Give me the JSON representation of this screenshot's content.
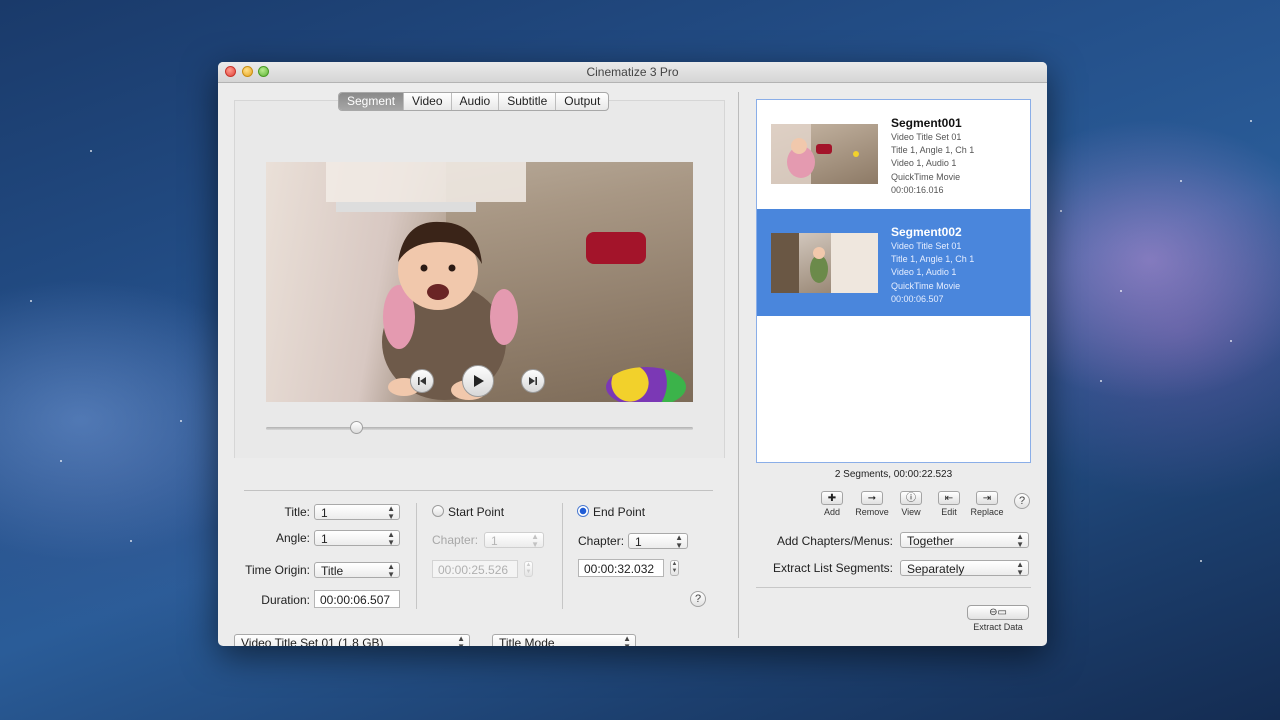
{
  "window": {
    "title": "Cinematize 3 Pro"
  },
  "tabs": [
    {
      "label": "Segment",
      "active": true
    },
    {
      "label": "Video",
      "active": false
    },
    {
      "label": "Audio",
      "active": false
    },
    {
      "label": "Subtitle",
      "active": false
    },
    {
      "label": "Output",
      "active": false
    }
  ],
  "player": {
    "position_fraction": 0.21
  },
  "props": {
    "title_label": "Title:",
    "title_value": "1",
    "angle_label": "Angle:",
    "angle_value": "1",
    "time_origin_label": "Time Origin:",
    "time_origin_value": "Title",
    "duration_label": "Duration:",
    "duration_value": "00:00:06.507",
    "start_point_label": "Start Point",
    "start_chapter_label": "Chapter:",
    "start_chapter_value": "1",
    "start_time": "00:00:25.526",
    "end_point_label": "End Point",
    "end_chapter_label": "Chapter:",
    "end_chapter_value": "1",
    "end_time": "00:00:32.032",
    "help": "?"
  },
  "bottom": {
    "title_set": "Video Title Set 01 (1.8 GB)",
    "mode": "Title Mode"
  },
  "segments": [
    {
      "name": "Segment001",
      "lines": [
        "Video Title Set 01",
        "Title 1, Angle 1, Ch 1",
        "Video 1, Audio 1",
        "QuickTime Movie",
        "00:00:16.016"
      ],
      "selected": false
    },
    {
      "name": "Segment002",
      "lines": [
        "Video Title Set 01",
        "Title 1, Angle 1, Ch 1",
        "Video 1, Audio 1",
        "QuickTime Movie",
        "00:00:06.507"
      ],
      "selected": true
    }
  ],
  "summary": "2 Segments, 00:00:22.523",
  "toolbar": {
    "add": "Add",
    "remove": "Remove",
    "view": "View",
    "edit": "Edit",
    "replace": "Replace",
    "help": "?"
  },
  "options": {
    "chapters_label": "Add Chapters/Menus:",
    "chapters_value": "Together",
    "extract_label": "Extract List Segments:",
    "extract_value": "Separately"
  },
  "extract_button": {
    "label": "Extract Data"
  },
  "colors": {
    "selection": "#4a86dc",
    "radio_on": "#1f5cd6"
  }
}
